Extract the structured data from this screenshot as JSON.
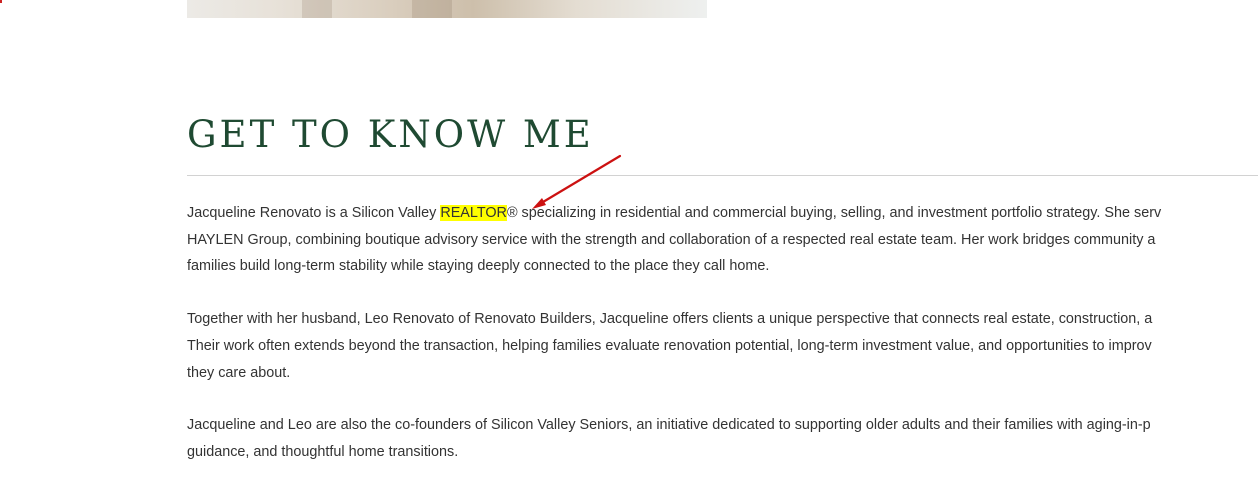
{
  "hero": {
    "image_alt": "Portrait photo (cropped)"
  },
  "section": {
    "title": "GET TO KNOW ME"
  },
  "bio": {
    "p1": {
      "before": "Jacqueline Renovato is a Silicon Valley ",
      "highlight": "REALTOR",
      "after_l1": "® specializing in residential and commercial buying, selling, and investment portfolio strategy. She serv",
      "l2": "HAYLEN Group, combining boutique advisory service with the strength and collaboration of a respected real estate team. Her work bridges community a",
      "l3": "families build long-term stability while staying deeply connected to the place they call home."
    },
    "p2": {
      "l1": "Together with her husband, Leo Renovato of Renovato Builders, Jacqueline offers clients a unique perspective that connects real estate, construction, a",
      "l2": "Their work often extends beyond the transaction, helping families evaluate renovation potential, long-term investment value, and opportunities to improv",
      "l3": "they care about."
    },
    "p3": {
      "l1": "Jacqueline and Leo are also the co-founders of Silicon Valley Seniors, an initiative dedicated to supporting older adults and their families with aging-in-p",
      "l2": "guidance, and thoughtful home transitions."
    }
  },
  "colors": {
    "title": "#1f4a32",
    "body_text": "#333333",
    "highlight": "#ffff00",
    "annotation_arrow": "#cc1111",
    "divider": "#d2d2d2"
  },
  "icons": {
    "annotation": "red-arrow-icon"
  }
}
